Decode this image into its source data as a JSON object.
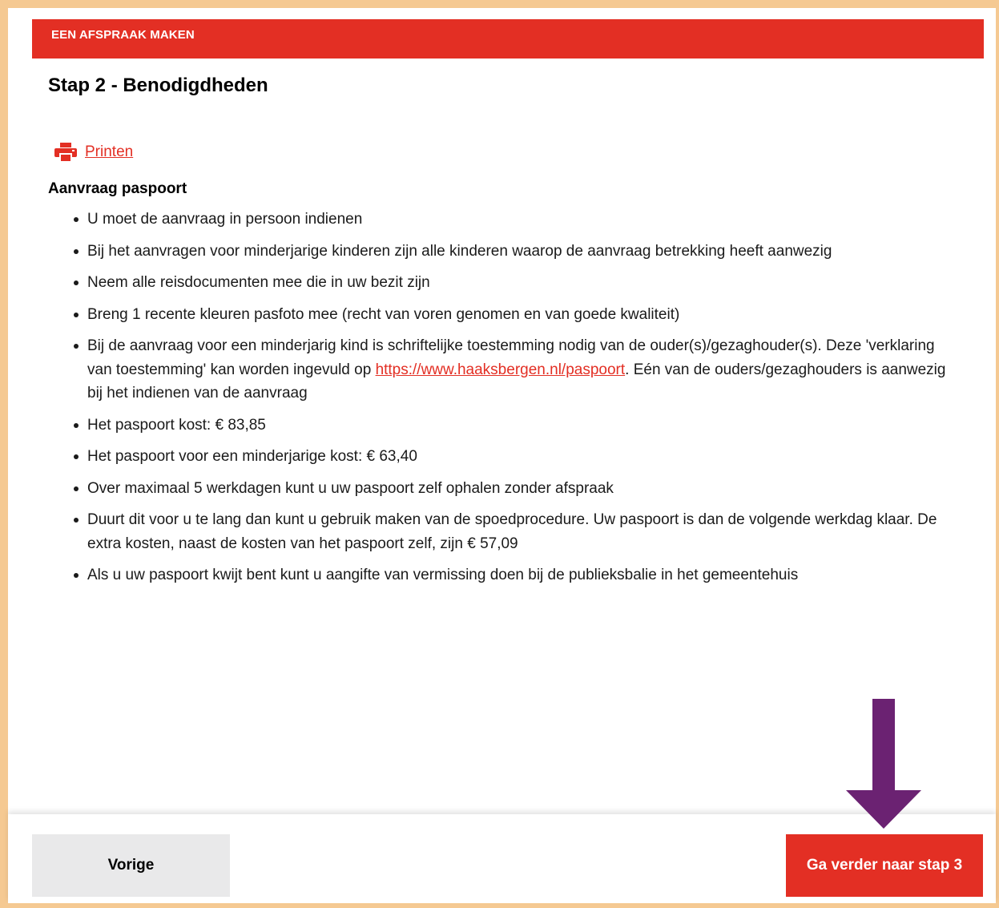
{
  "header": {
    "title": "EEN AFSPRAAK MAKEN",
    "accent_color": "#e32f24"
  },
  "step": {
    "title": "Stap 2 - Benodigdheden"
  },
  "print": {
    "icon": "printer-icon",
    "label": "Printen"
  },
  "requirements": {
    "title": "Aanvraag paspoort",
    "items": [
      "U moet de aanvraag in persoon indienen",
      "Bij het aanvragen voor minderjarige kinderen zijn alle kinderen waarop de aanvraag betrekking heeft aanwezig",
      "Neem alle reisdocumenten mee die in uw bezit zijn",
      "Breng 1 recente kleuren pasfoto mee (recht van voren genomen en van goede kwaliteit)",
      {
        "before": "Bij de aanvraag voor een minderjarig kind is schriftelijke toestemming nodig van de ouder(s)/gezaghouder(s). Deze 'verklaring van toestemming' kan worden ingevuld op ",
        "link": "https://www.haaksbergen.nl/paspoort",
        "after": ". Eén van de ouders/gezaghouders is aanwezig bij het indienen van de aanvraag"
      },
      "Het paspoort kost: € 83,85",
      "Het paspoort voor een minderjarige kost: € 63,40",
      "Over maximaal 5 werkdagen kunt u uw paspoort zelf ophalen zonder afspraak",
      "Duurt dit voor u te lang dan kunt u gebruik maken van de spoedprocedure. Uw paspoort is dan de volgende werkdag klaar. De extra kosten, naast de kosten van het paspoort zelf, zijn € 57,09",
      "Als u uw paspoort kwijt bent kunt u aangifte van vermissing doen bij de publieksbalie in het gemeentehuis"
    ]
  },
  "footer": {
    "prev_label": "Vorige",
    "next_label": "Ga verder naar stap 3"
  },
  "annotation": {
    "icon": "down-arrow-icon",
    "color": "#6b2272"
  }
}
